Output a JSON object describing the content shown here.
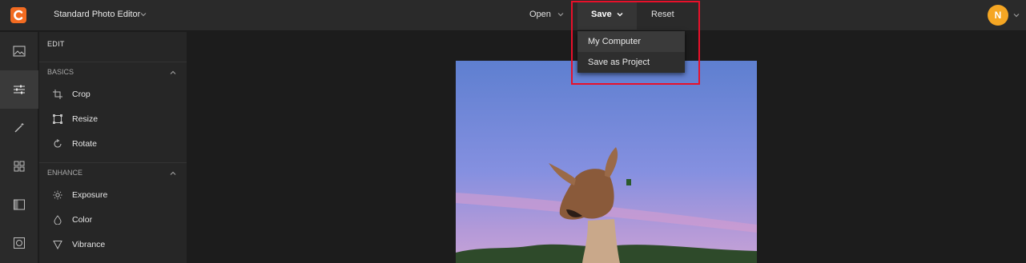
{
  "header": {
    "app_title": "Standard Photo Editor",
    "open_label": "Open",
    "save_label": "Save",
    "reset_label": "Reset",
    "avatar_initial": "N"
  },
  "save_menu": {
    "items": [
      "My Computer",
      "Save as Project"
    ]
  },
  "rail": {
    "icons": [
      "image-icon",
      "sliders-icon",
      "magic-wand-icon",
      "grid-icon",
      "panel-icon",
      "frame-icon"
    ],
    "active": "sliders-icon"
  },
  "panel": {
    "title": "EDIT",
    "sections": [
      {
        "label": "BASICS",
        "tools": [
          {
            "label": "Crop",
            "icon": "crop-icon"
          },
          {
            "label": "Resize",
            "icon": "resize-icon"
          },
          {
            "label": "Rotate",
            "icon": "rotate-icon"
          }
        ]
      },
      {
        "label": "ENHANCE",
        "tools": [
          {
            "label": "Exposure",
            "icon": "exposure-icon"
          },
          {
            "label": "Color",
            "icon": "color-drop-icon"
          },
          {
            "label": "Vibrance",
            "icon": "vibrance-icon"
          }
        ]
      }
    ]
  },
  "colors": {
    "accent_avatar": "#f5a623",
    "brand_logo": "#f26b21",
    "highlight_border": "#e8102a"
  }
}
